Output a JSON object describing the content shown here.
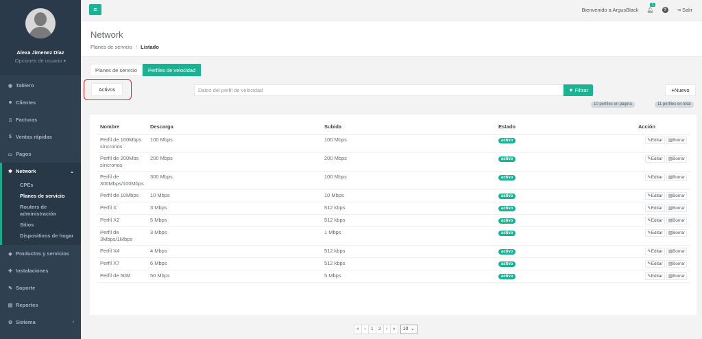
{
  "user": {
    "name": "Alexa Jimenez Díaz",
    "options_label": "Opciones de usuario ▾"
  },
  "nav": {
    "tablero": "Tablero",
    "clientes": "Clientes",
    "facturas": "Facturas",
    "ventas": "Ventas rápidas",
    "pagos": "Pagos",
    "network": "Network",
    "network_sub": [
      "CPEs",
      "Planes de servicio",
      "Routers de administración",
      "Sitios",
      "Dispositivos de hogar"
    ],
    "productos": "Productos y servicios",
    "instalaciones": "Instalaciones",
    "soporte": "Soporte",
    "reportes": "Reportes",
    "sistema": "Sistema"
  },
  "topbar": {
    "welcome": "Bienvenido a ArgusBlack",
    "notifications": "1",
    "logout": "Salir"
  },
  "page": {
    "title": "Network",
    "breadcrumb_parent": "Planes de servicio",
    "breadcrumb_sep": "/",
    "breadcrumb_current": "Listado"
  },
  "tabs": [
    "Planes de servicio",
    "Perfiles de velocidad"
  ],
  "filter": {
    "activos": "Activos",
    "placeholder": "Datos del perfil de velocidad",
    "filtrar": "Filtrar",
    "nuevo": "Nuevo"
  },
  "counts": {
    "on_page": "10 perfiles en página",
    "total": "11 perfiles en total"
  },
  "table": {
    "headers": [
      "Nombre",
      "Descarga",
      "Subida",
      "Estado",
      "Acción"
    ],
    "edit": "Editar",
    "delete": "Borrar",
    "rows": [
      {
        "name": "Perfil de 100Mbps síncronos",
        "down": "100 Mbps",
        "up": "100 Mbps",
        "status": "activo"
      },
      {
        "name": "Perfil de 200Mbs síncronos",
        "down": "200 Mbps",
        "up": "200 Mbps",
        "status": "activo"
      },
      {
        "name": "Perfil de 300Mbps/100Mbps",
        "down": "300 Mbps",
        "up": "100 Mbps",
        "status": "activo"
      },
      {
        "name": "Perfil de 10Mbps",
        "down": "10 Mbps",
        "up": "10 Mbps",
        "status": "activo"
      },
      {
        "name": "Perfil X",
        "down": "3 Mbps",
        "up": "512 kbps",
        "status": "activo"
      },
      {
        "name": "Perfil X2",
        "down": "5 Mbps",
        "up": "512 kbps",
        "status": "activo"
      },
      {
        "name": "Perfil de 3Mbps/1Mbps",
        "down": "3 Mbps",
        "up": "1 Mbps",
        "status": "activo"
      },
      {
        "name": "Perfil X4",
        "down": "4 Mbps",
        "up": "512 kbps",
        "status": "activo"
      },
      {
        "name": "Perfil X7",
        "down": "6 Mbps",
        "up": "512 kbps",
        "status": "activo"
      },
      {
        "name": "Perfil de 50M",
        "down": "50 Mbps",
        "up": "5 Mbps",
        "status": "activo"
      }
    ]
  },
  "pagination": {
    "first": "«",
    "prev": "‹",
    "pages": [
      "1",
      "2"
    ],
    "next": "›",
    "last": "»",
    "per_page": "10"
  }
}
